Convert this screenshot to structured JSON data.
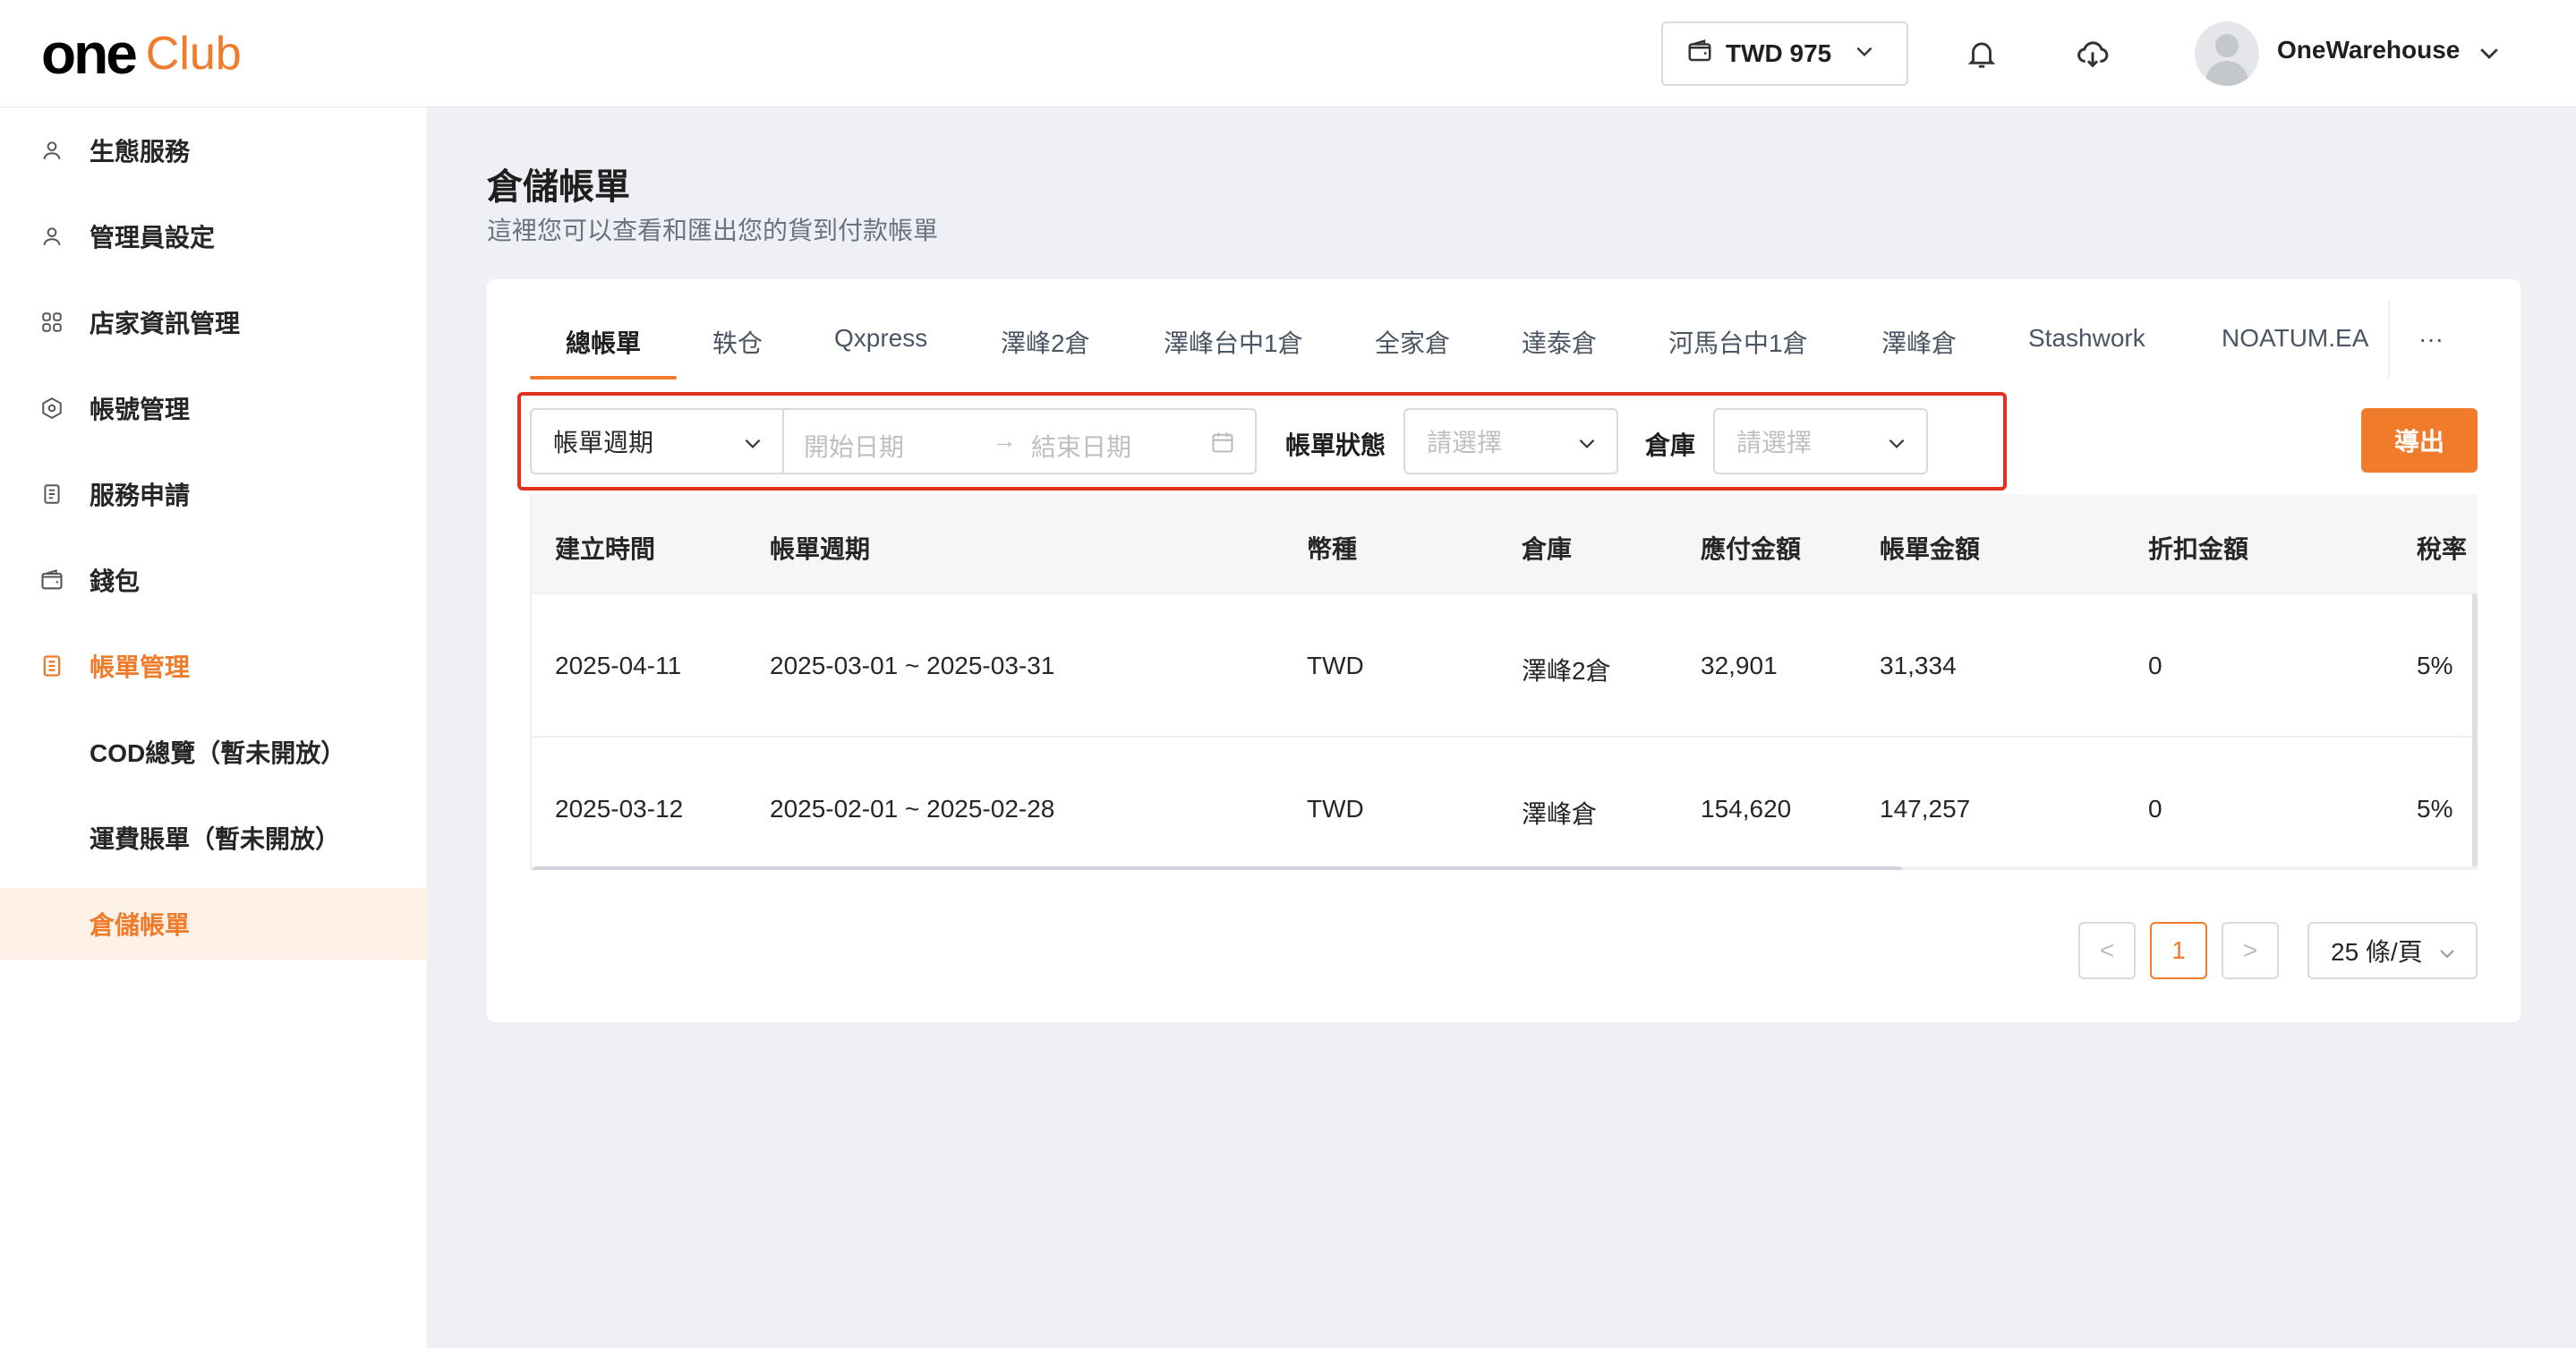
{
  "brand": {
    "part1": "one",
    "part2": "Club"
  },
  "header": {
    "wallet_label": "TWD 975",
    "user_name": "OneWarehouse"
  },
  "sidebar": {
    "items": [
      {
        "label": "生態服務",
        "icon": "user-icon"
      },
      {
        "label": "管理員設定",
        "icon": "user-icon"
      },
      {
        "label": "店家資訊管理",
        "icon": "apps-icon"
      },
      {
        "label": "帳號管理",
        "icon": "settings-icon"
      },
      {
        "label": "服務申請",
        "icon": "document-icon"
      },
      {
        "label": "錢包",
        "icon": "wallet-icon"
      },
      {
        "label": "帳單管理",
        "icon": "bill-icon"
      }
    ],
    "subitems": [
      {
        "label": "COD總覽（暫未開放）"
      },
      {
        "label": "運費賬單（暫未開放）"
      },
      {
        "label": "倉儲帳單"
      }
    ]
  },
  "page": {
    "title": "倉儲帳單",
    "subtitle": "這裡您可以查看和匯出您的貨到付款帳單"
  },
  "tabs": [
    "總帳單",
    "轶仓",
    "Qxpress",
    "澤峰2倉",
    "澤峰台中1倉",
    "全家倉",
    "達泰倉",
    "河馬台中1倉",
    "澤峰倉",
    "Stashwork",
    "NOATUM.EA"
  ],
  "tab_more": "···",
  "filters": {
    "period_select": "帳單週期",
    "start_placeholder": "開始日期",
    "arrow": "→",
    "end_placeholder": "結束日期",
    "status_label": "帳單狀態",
    "status_placeholder": "請選擇",
    "warehouse_label": "倉庫",
    "warehouse_placeholder": "請選擇",
    "export_label": "導出"
  },
  "table": {
    "columns": [
      "建立時間",
      "帳單週期",
      "幣種",
      "倉庫",
      "應付金額",
      "帳單金額",
      "折扣金額",
      "稅率"
    ],
    "rows": [
      [
        "2025-04-11",
        "2025-03-01 ~ 2025-03-31",
        "TWD",
        "澤峰2倉",
        "32,901",
        "31,334",
        "0",
        "5%"
      ],
      [
        "2025-03-12",
        "2025-02-01 ~ 2025-02-28",
        "TWD",
        "澤峰倉",
        "154,620",
        "147,257",
        "0",
        "5%"
      ]
    ]
  },
  "pagination": {
    "prev": "<",
    "current": "1",
    "next": ">",
    "page_size": "25 條/頁"
  },
  "colors": {
    "accent": "#f07c2b",
    "highlight_border": "#e0301e"
  }
}
